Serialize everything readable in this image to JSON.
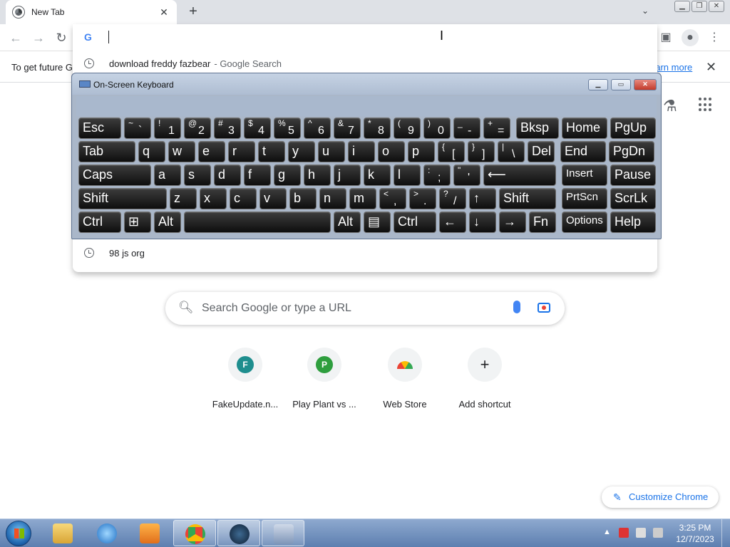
{
  "browser": {
    "tab_title": "New Tab",
    "omnibox_value": "",
    "suggestions": [
      {
        "text": "download freddy fazbear",
        "suffix": "- Google Search"
      },
      {
        "text": "98 js org",
        "suffix": ""
      }
    ],
    "infobar": {
      "text": "To get future G",
      "link": "earn more"
    },
    "search_placeholder": "Search Google or type a URL",
    "shortcuts": [
      {
        "label": "FakeUpdate.n...",
        "letter": "F",
        "color": "#1e8e8e"
      },
      {
        "label": "Play Plant vs ...",
        "letter": "P",
        "color": "#2e9e3e"
      },
      {
        "label": "Web Store",
        "letter": "",
        "color": "#ea4335"
      },
      {
        "label": "Add shortcut",
        "letter": "+",
        "color": ""
      }
    ],
    "customize_label": "Customize Chrome"
  },
  "osk": {
    "title": "On-Screen Keyboard",
    "keys": [
      [
        "Esc",
        "~ `",
        "! 1",
        "@ 2",
        "# 3",
        "$ 4",
        "% 5",
        "^ 6",
        "& 7",
        "* 8",
        "( 9",
        ") 0",
        "_ -",
        "+ =",
        "Bksp",
        "Home",
        "PgUp"
      ],
      [
        "Tab",
        "q",
        "w",
        "e",
        "r",
        "t",
        "y",
        "u",
        "i",
        "o",
        "p",
        "{ [",
        "} ]",
        "| \\",
        "Del",
        "End",
        "PgDn"
      ],
      [
        "Caps",
        "a",
        "s",
        "d",
        "f",
        "g",
        "h",
        "j",
        "k",
        "l",
        ": ;",
        "\" '",
        "⟵",
        "Insert",
        "Pause"
      ],
      [
        "Shift",
        "z",
        "x",
        "c",
        "v",
        "b",
        "n",
        "m",
        "< ,",
        "> .",
        "? /",
        "↑",
        "Shift",
        "PrtScn",
        "ScrLk"
      ],
      [
        "Ctrl",
        "⊞",
        "Alt",
        "",
        "Alt",
        "▤",
        "Ctrl",
        "←",
        "↓",
        "→",
        "Fn",
        "Options",
        "Help"
      ]
    ]
  },
  "taskbar": {
    "time": "3:25 PM",
    "date": "12/7/2023"
  }
}
